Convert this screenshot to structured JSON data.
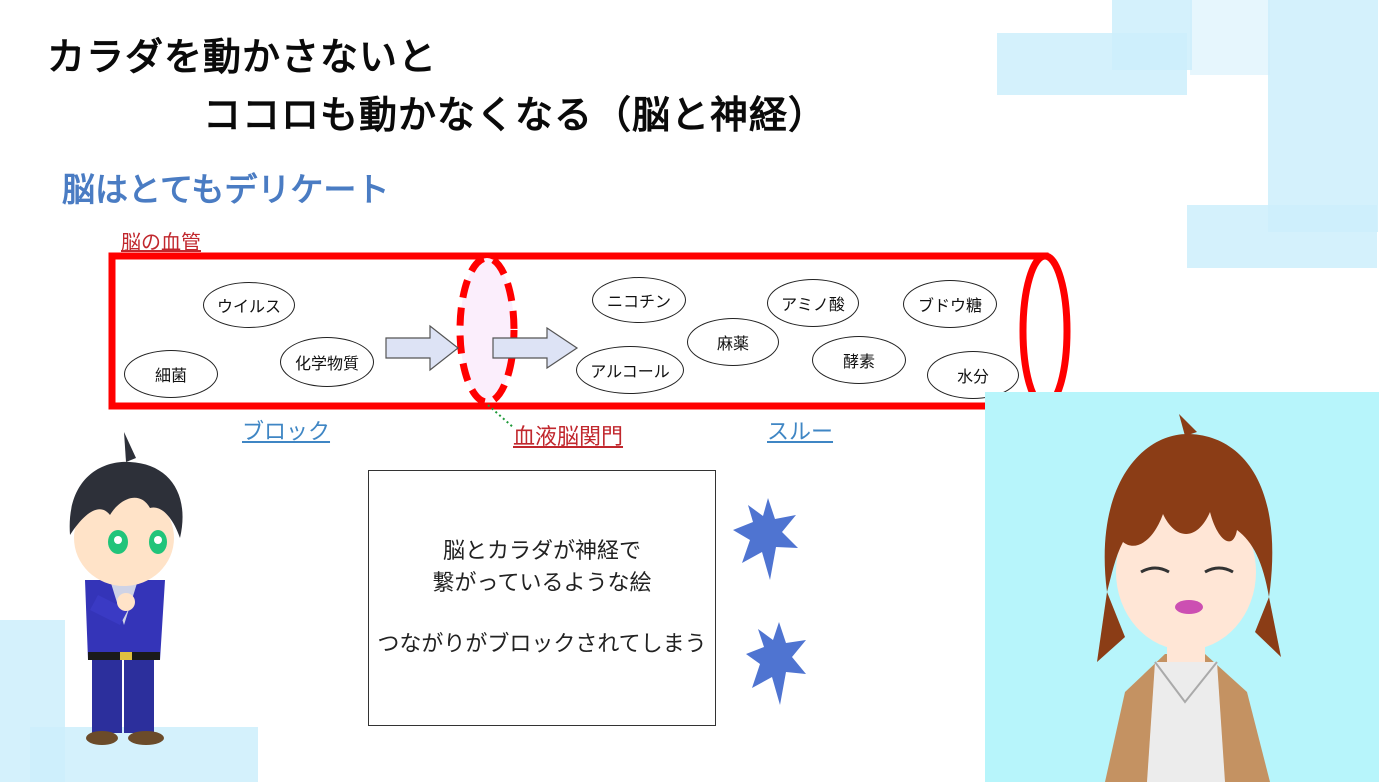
{
  "slide": {
    "title_line1": "カラダを動かさないと",
    "title_line2": "ココロも動かなくなる（脳と神経）",
    "subtitle": "脳はとてもデリケート",
    "vessel_label": "脳の血管",
    "block_label": "ブロック",
    "bbb_label": "血液脳関門",
    "through_label": "スルー"
  },
  "blocked_items": [
    "ウイルス",
    "細菌",
    "化学物質"
  ],
  "through_items": [
    "ニコチン",
    "アルコール",
    "麻薬",
    "アミノ酸",
    "酵素",
    "ブドウ糖",
    "水分"
  ],
  "placeholder_box": {
    "line1": "脳とカラダが神経で",
    "line2": "繋がっているような絵",
    "line3": "つながりがブロックされてしまう"
  },
  "colors": {
    "vessel_red": "#ff0000",
    "subtitle_blue": "#4a7cc3",
    "link_blue": "#3f86c4",
    "label_red": "#c1272d",
    "arrow_fill": "#dde3f5",
    "spark_blue": "#4f74d1",
    "avatar_bg": "#b7f5fb",
    "deco_blue": "#cdeefb"
  }
}
